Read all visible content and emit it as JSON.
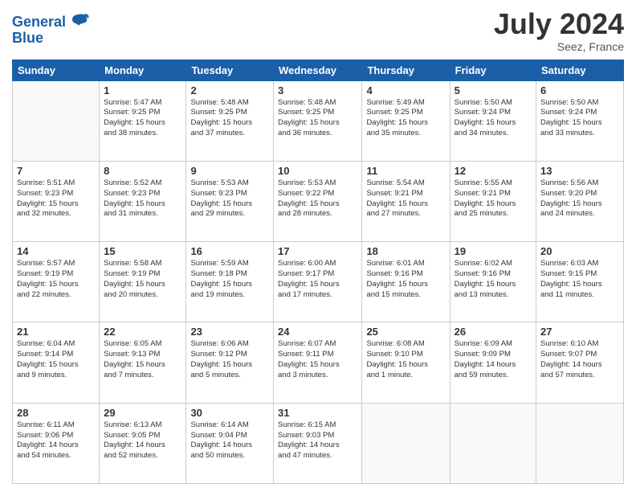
{
  "header": {
    "logo_line1": "General",
    "logo_line2": "Blue",
    "month": "July 2024",
    "location": "Seez, France"
  },
  "days_of_week": [
    "Sunday",
    "Monday",
    "Tuesday",
    "Wednesday",
    "Thursday",
    "Friday",
    "Saturday"
  ],
  "weeks": [
    [
      {
        "day": "",
        "info": ""
      },
      {
        "day": "1",
        "info": "Sunrise: 5:47 AM\nSunset: 9:25 PM\nDaylight: 15 hours\nand 38 minutes."
      },
      {
        "day": "2",
        "info": "Sunrise: 5:48 AM\nSunset: 9:25 PM\nDaylight: 15 hours\nand 37 minutes."
      },
      {
        "day": "3",
        "info": "Sunrise: 5:48 AM\nSunset: 9:25 PM\nDaylight: 15 hours\nand 36 minutes."
      },
      {
        "day": "4",
        "info": "Sunrise: 5:49 AM\nSunset: 9:25 PM\nDaylight: 15 hours\nand 35 minutes."
      },
      {
        "day": "5",
        "info": "Sunrise: 5:50 AM\nSunset: 9:24 PM\nDaylight: 15 hours\nand 34 minutes."
      },
      {
        "day": "6",
        "info": "Sunrise: 5:50 AM\nSunset: 9:24 PM\nDaylight: 15 hours\nand 33 minutes."
      }
    ],
    [
      {
        "day": "7",
        "info": "Sunrise: 5:51 AM\nSunset: 9:23 PM\nDaylight: 15 hours\nand 32 minutes."
      },
      {
        "day": "8",
        "info": "Sunrise: 5:52 AM\nSunset: 9:23 PM\nDaylight: 15 hours\nand 31 minutes."
      },
      {
        "day": "9",
        "info": "Sunrise: 5:53 AM\nSunset: 9:23 PM\nDaylight: 15 hours\nand 29 minutes."
      },
      {
        "day": "10",
        "info": "Sunrise: 5:53 AM\nSunset: 9:22 PM\nDaylight: 15 hours\nand 28 minutes."
      },
      {
        "day": "11",
        "info": "Sunrise: 5:54 AM\nSunset: 9:21 PM\nDaylight: 15 hours\nand 27 minutes."
      },
      {
        "day": "12",
        "info": "Sunrise: 5:55 AM\nSunset: 9:21 PM\nDaylight: 15 hours\nand 25 minutes."
      },
      {
        "day": "13",
        "info": "Sunrise: 5:56 AM\nSunset: 9:20 PM\nDaylight: 15 hours\nand 24 minutes."
      }
    ],
    [
      {
        "day": "14",
        "info": "Sunrise: 5:57 AM\nSunset: 9:19 PM\nDaylight: 15 hours\nand 22 minutes."
      },
      {
        "day": "15",
        "info": "Sunrise: 5:58 AM\nSunset: 9:19 PM\nDaylight: 15 hours\nand 20 minutes."
      },
      {
        "day": "16",
        "info": "Sunrise: 5:59 AM\nSunset: 9:18 PM\nDaylight: 15 hours\nand 19 minutes."
      },
      {
        "day": "17",
        "info": "Sunrise: 6:00 AM\nSunset: 9:17 PM\nDaylight: 15 hours\nand 17 minutes."
      },
      {
        "day": "18",
        "info": "Sunrise: 6:01 AM\nSunset: 9:16 PM\nDaylight: 15 hours\nand 15 minutes."
      },
      {
        "day": "19",
        "info": "Sunrise: 6:02 AM\nSunset: 9:16 PM\nDaylight: 15 hours\nand 13 minutes."
      },
      {
        "day": "20",
        "info": "Sunrise: 6:03 AM\nSunset: 9:15 PM\nDaylight: 15 hours\nand 11 minutes."
      }
    ],
    [
      {
        "day": "21",
        "info": "Sunrise: 6:04 AM\nSunset: 9:14 PM\nDaylight: 15 hours\nand 9 minutes."
      },
      {
        "day": "22",
        "info": "Sunrise: 6:05 AM\nSunset: 9:13 PM\nDaylight: 15 hours\nand 7 minutes."
      },
      {
        "day": "23",
        "info": "Sunrise: 6:06 AM\nSunset: 9:12 PM\nDaylight: 15 hours\nand 5 minutes."
      },
      {
        "day": "24",
        "info": "Sunrise: 6:07 AM\nSunset: 9:11 PM\nDaylight: 15 hours\nand 3 minutes."
      },
      {
        "day": "25",
        "info": "Sunrise: 6:08 AM\nSunset: 9:10 PM\nDaylight: 15 hours\nand 1 minute."
      },
      {
        "day": "26",
        "info": "Sunrise: 6:09 AM\nSunset: 9:09 PM\nDaylight: 14 hours\nand 59 minutes."
      },
      {
        "day": "27",
        "info": "Sunrise: 6:10 AM\nSunset: 9:07 PM\nDaylight: 14 hours\nand 57 minutes."
      }
    ],
    [
      {
        "day": "28",
        "info": "Sunrise: 6:11 AM\nSunset: 9:06 PM\nDaylight: 14 hours\nand 54 minutes."
      },
      {
        "day": "29",
        "info": "Sunrise: 6:13 AM\nSunset: 9:05 PM\nDaylight: 14 hours\nand 52 minutes."
      },
      {
        "day": "30",
        "info": "Sunrise: 6:14 AM\nSunset: 9:04 PM\nDaylight: 14 hours\nand 50 minutes."
      },
      {
        "day": "31",
        "info": "Sunrise: 6:15 AM\nSunset: 9:03 PM\nDaylight: 14 hours\nand 47 minutes."
      },
      {
        "day": "",
        "info": ""
      },
      {
        "day": "",
        "info": ""
      },
      {
        "day": "",
        "info": ""
      }
    ]
  ]
}
